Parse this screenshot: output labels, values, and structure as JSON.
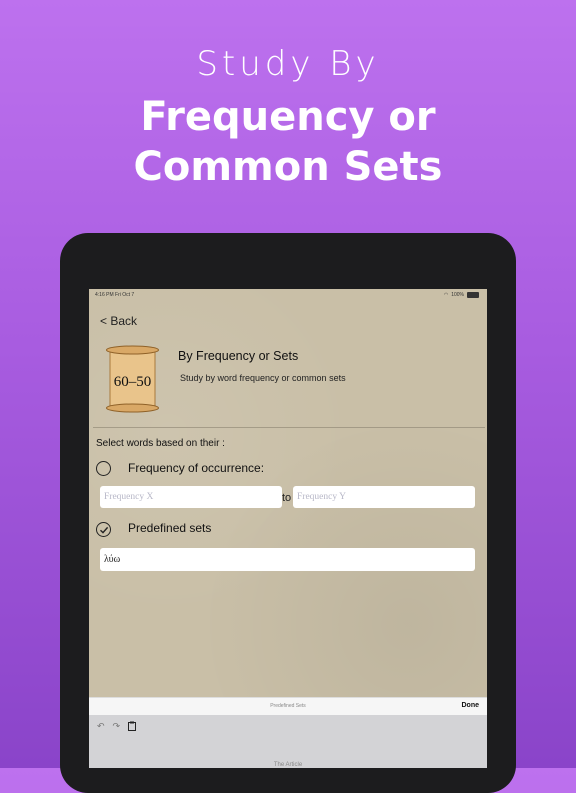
{
  "promo": {
    "subtitle": "Study By",
    "title_line1": "Frequency or",
    "title_line2": "Common Sets"
  },
  "status_bar": {
    "time": "4:16 PM   Fri Oct 7",
    "battery": "100%"
  },
  "nav": {
    "back_label": "< Back"
  },
  "header": {
    "image_text": "60–50",
    "title": "By Frequency or Sets",
    "subtitle": "Study by word frequency or common sets"
  },
  "form": {
    "select_label": "Select words based on their :",
    "option_frequency": "Frequency of occurrence:",
    "freq_x_placeholder": "Frequency X",
    "to_label": "to",
    "freq_y_placeholder": "Frequency Y",
    "option_predefined": "Predefined sets",
    "predefined_value": "λύω"
  },
  "keyboard": {
    "accessory_title": "Predefined Sets",
    "done_label": "Done",
    "undo_icon": "↶",
    "redo_icon": "↷",
    "paste_icon": "📋",
    "hint": "The Article"
  }
}
